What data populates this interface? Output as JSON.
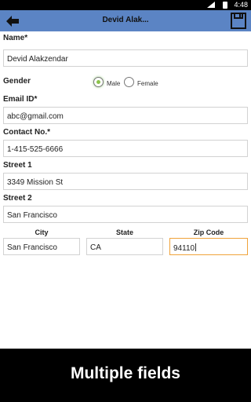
{
  "status_bar": {
    "time": "4:48"
  },
  "action_bar": {
    "title": "Devid Alak..."
  },
  "form": {
    "name_label": "Name*",
    "name_value": "Devid Alakzendar",
    "gender_label": "Gender",
    "gender_options": [
      "Male",
      "Female"
    ],
    "gender_selected": "Male",
    "email_label": "Email ID*",
    "email_value": "abc@gmail.com",
    "contact_label": "Contact No.*",
    "contact_value": "1-415-525-6666",
    "street1_label": "Street 1",
    "street1_value": "3349 Mission St",
    "street2_label": "Street 2",
    "street2_value": "San Francisco",
    "city_label": "City",
    "city_value": "San Francisco",
    "state_label": "State",
    "state_value": "CA",
    "zip_label": "Zip Code",
    "zip_value": "94110"
  },
  "caption": "Multiple fields",
  "colors": {
    "action_bar": "#5b84c4",
    "accent_focus": "#f0a33a",
    "radio_selected": "#8bc34a"
  }
}
